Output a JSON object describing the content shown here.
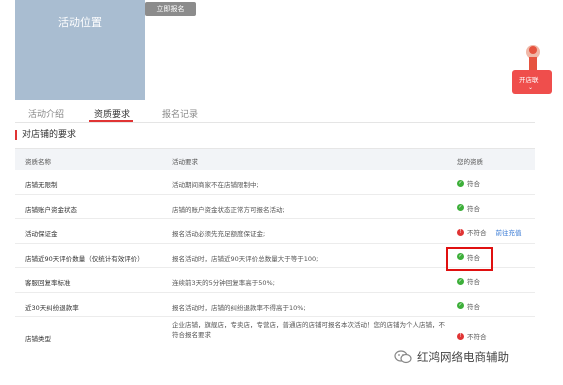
{
  "activity": {
    "image_label": "活动位置",
    "join_button": "立即报名"
  },
  "float_badge": {
    "label": "开店联",
    "chevron": "⌄"
  },
  "tabs": [
    {
      "label": "活动介绍",
      "active": false
    },
    {
      "label": "资质要求",
      "active": true
    },
    {
      "label": "报名记录",
      "active": false
    }
  ],
  "section_title": "对店铺的要求",
  "table": {
    "headers": [
      "资质名称",
      "活动要求",
      "您的资质"
    ],
    "rows": [
      {
        "name": "店铺无限制",
        "requirement": "活动期间商家不在店铺限制中;",
        "status": "符合",
        "status_type": "ok",
        "link": ""
      },
      {
        "name": "店铺账户资金状态",
        "requirement": "店铺的账户资金状态正常方可报名活动;",
        "status": "符合",
        "status_type": "ok",
        "link": ""
      },
      {
        "name": "活动保证金",
        "requirement": "报名活动必须先充足额度保证金;",
        "status": "不符合",
        "status_type": "bad",
        "link": "前往充值"
      },
      {
        "name": "店铺近90天评价数量（仅统计有效评价）",
        "requirement": "报名活动时，店铺近90天评价总数量大于等于100;",
        "status": "符合",
        "status_type": "ok",
        "link": ""
      },
      {
        "name": "客服回复率标准",
        "requirement": "连续前3天的5分钟回复率高于50%;",
        "status": "符合",
        "status_type": "ok",
        "link": ""
      },
      {
        "name": "近30天纠纷退款率",
        "requirement": "报名活动时，店铺的纠纷退款率不得高于10%;",
        "status": "符合",
        "status_type": "ok",
        "link": ""
      },
      {
        "name": "店铺类型",
        "requirement": "企业店铺，旗舰店，专卖店，专营店，普通店的店铺可报名本次活动！您的店铺为个人店铺，不符合报名要求",
        "status": "不符合",
        "status_type": "bad",
        "link": ""
      }
    ]
  },
  "watermark": {
    "text": "红鸿网络电商辅助"
  },
  "colors": {
    "accent": "#e03434",
    "ok": "#3daf3a",
    "link": "#3a7bd5",
    "image_bg": "#a9bdd1"
  }
}
